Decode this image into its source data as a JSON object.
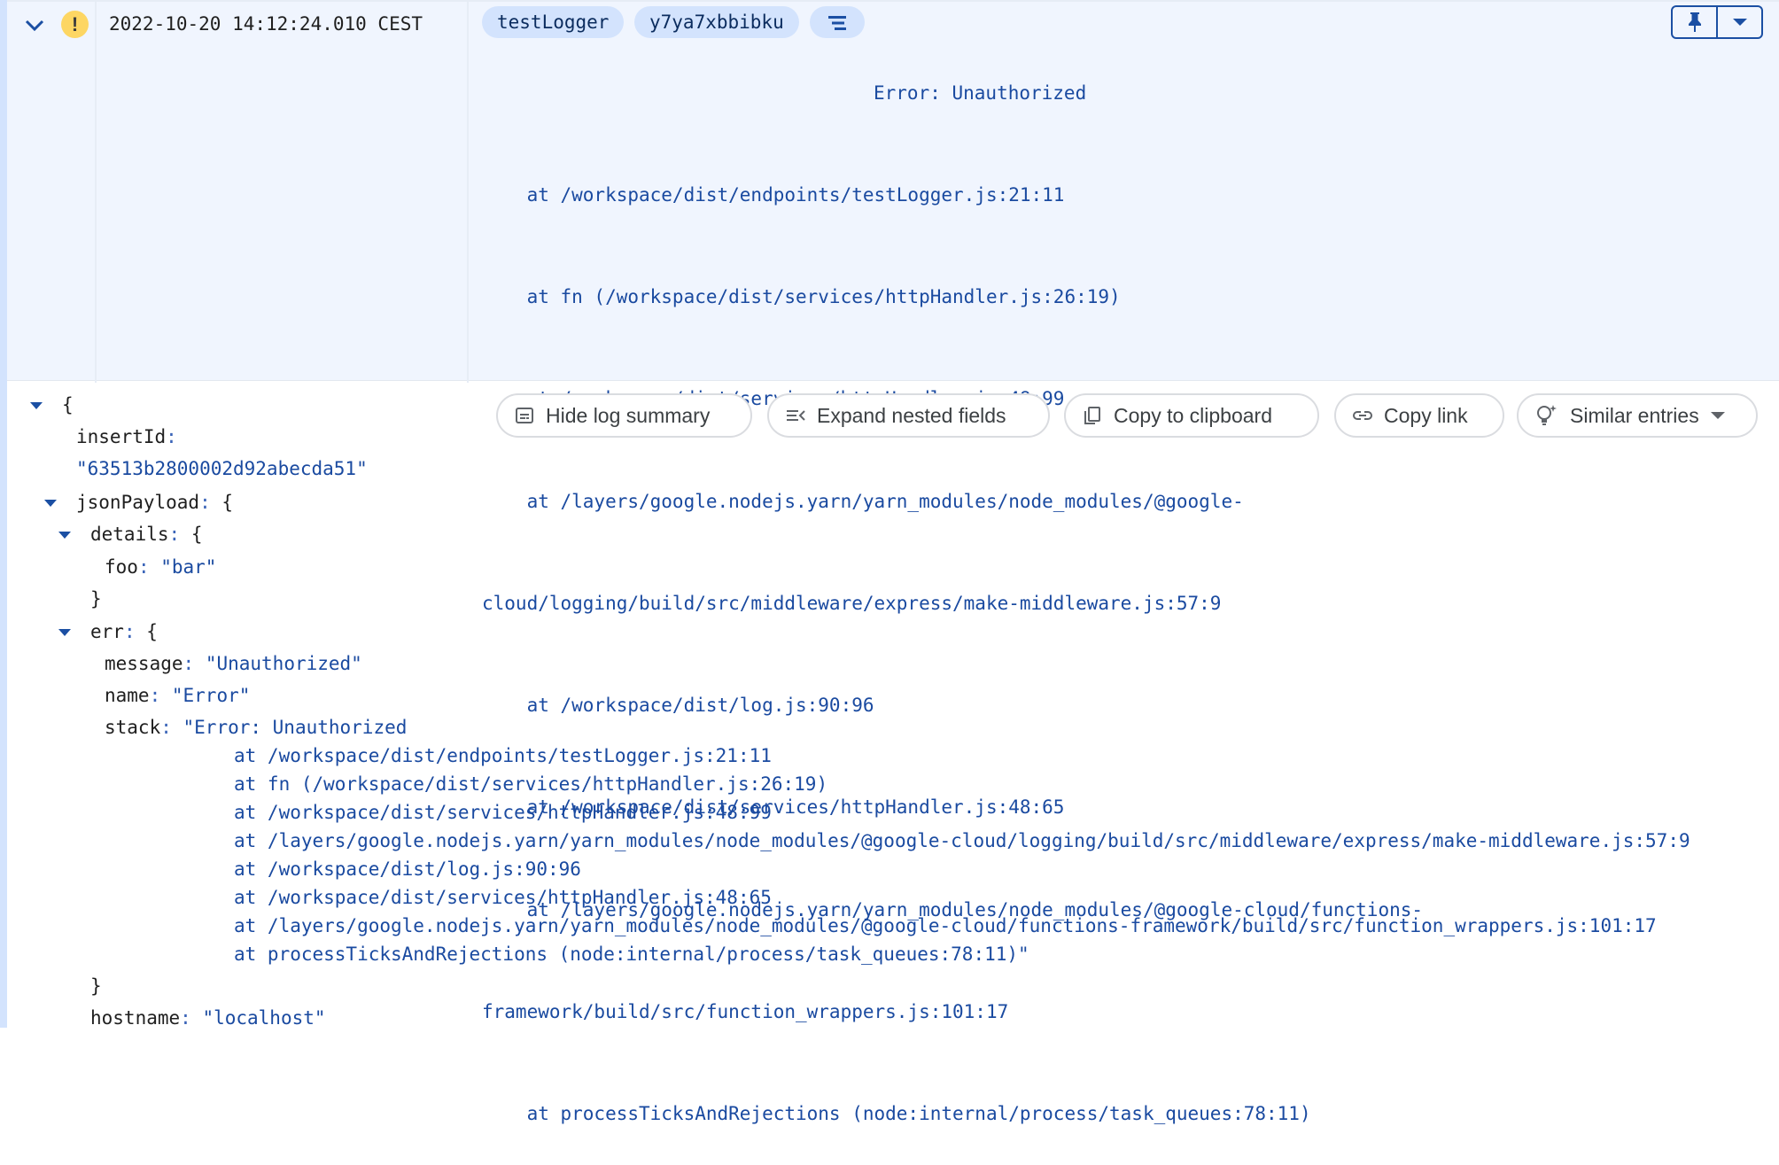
{
  "log_entry": {
    "severity": "warning",
    "severity_symbol": "!",
    "timestamp": "2022-10-20 14:12:24.010 CEST",
    "chips": [
      "testLogger",
      "y7ya7xbbibku"
    ],
    "summary_icon": "format-align-center-icon",
    "summary_lines": [
      "Error: Unauthorized",
      "    at /workspace/dist/endpoints/testLogger.js:21:11",
      "    at fn (/workspace/dist/services/httpHandler.js:26:19)",
      "    at /workspace/dist/services/httpHandler.js:48:99",
      "    at /layers/google.nodejs.yarn/yarn_modules/node_modules/@google-",
      "cloud/logging/build/src/middleware/express/make-middleware.js:57:9",
      "    at /workspace/dist/log.js:90:96",
      "    at /workspace/dist/services/httpHandler.js:48:65",
      "    at /layers/google.nodejs.yarn/yarn_modules/node_modules/@google-cloud/functions-",
      "framework/build/src/function_wrappers.js:101:17",
      "    at processTicksAndRejections (node:internal/process/task_queues:78:11)"
    ],
    "pin_label": "Pin",
    "colors": {
      "accent": "#1b4fa3",
      "chip_bg": "#d3e3fd",
      "header_bg": "#f0f5fe",
      "severity_warning": "#fdd663"
    }
  },
  "actions": {
    "hide_summary": "Hide log summary",
    "expand_nested": "Expand nested fields",
    "copy_clipboard": "Copy to clipboard",
    "copy_link": "Copy link",
    "similar_entries": "Similar entries"
  },
  "json": {
    "open_brace": "{",
    "close_brace": "}",
    "colon": ": ",
    "insertId_key": "insertId",
    "insertId_value": "\"63513b2800002d92abecda51\"",
    "jsonPayload_key": "jsonPayload",
    "details_key": "details",
    "foo_key": "foo",
    "foo_value": "\"bar\"",
    "err_key": "err",
    "message_key": "message",
    "message_value": "\"Unauthorized\"",
    "name_key": "name",
    "name_value": "\"Error\"",
    "stack_key": "stack",
    "stack_first": "\"Error: Unauthorized",
    "stack_lines": [
      "at /workspace/dist/endpoints/testLogger.js:21:11",
      "at fn (/workspace/dist/services/httpHandler.js:26:19)",
      "at /workspace/dist/services/httpHandler.js:48:99",
      "at /layers/google.nodejs.yarn/yarn_modules/node_modules/@google-cloud/logging/build/src/middleware/express/make-middleware.js:57:9",
      "at /workspace/dist/log.js:90:96",
      "at /workspace/dist/services/httpHandler.js:48:65",
      "at /layers/google.nodejs.yarn/yarn_modules/node_modules/@google-cloud/functions-framework/build/src/function_wrappers.js:101:17",
      "at processTicksAndRejections (node:internal/process/task_queues:78:11)\""
    ],
    "hostname_key": "hostname",
    "hostname_value": "\"localhost\""
  }
}
